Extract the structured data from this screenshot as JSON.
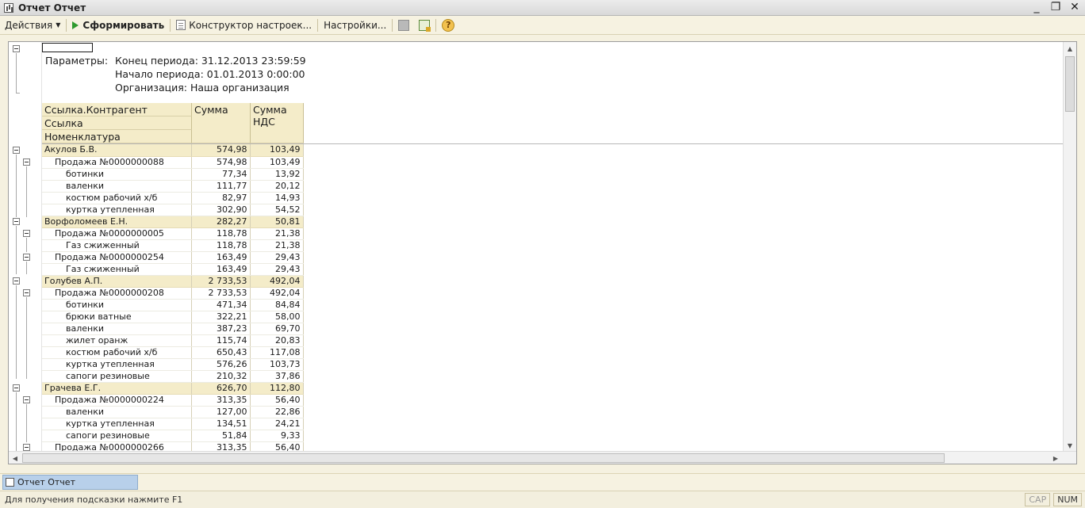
{
  "window": {
    "title": "Отчет  Отчет",
    "buttons": [
      "_",
      "❐",
      "✕"
    ]
  },
  "toolbar": {
    "actions_label": "Действия",
    "generate_label": "Сформировать",
    "constructor_label": "Конструктор настроек...",
    "settings_label": "Настройки...",
    "help_label": "?"
  },
  "report": {
    "params_label": "Параметры:",
    "params": [
      "Конец периода: 31.12.2013 23:59:59",
      "Начало периода: 01.01.2013 0:00:00",
      "Организация: Наша организация"
    ],
    "headers": {
      "group1": "Ссылка.Контрагент",
      "group2": "Ссылка",
      "group3": "Номенклатура",
      "sum": "Сумма",
      "vat_line1": "Сумма",
      "vat_line2": "НДС"
    },
    "rows": [
      {
        "level": 0,
        "name": "Акулов Б.В.",
        "sum": "574,98",
        "vat": "103,49"
      },
      {
        "level": 1,
        "name": "Продажа №0000000088",
        "sum": "574,98",
        "vat": "103,49"
      },
      {
        "level": 2,
        "name": "ботинки",
        "sum": "77,34",
        "vat": "13,92"
      },
      {
        "level": 2,
        "name": "валенки",
        "sum": "111,77",
        "vat": "20,12"
      },
      {
        "level": 2,
        "name": "костюм рабочий х/б",
        "sum": "82,97",
        "vat": "14,93"
      },
      {
        "level": 2,
        "name": "куртка утепленная",
        "sum": "302,90",
        "vat": "54,52"
      },
      {
        "level": 0,
        "name": "Ворфоломеев Е.Н.",
        "sum": "282,27",
        "vat": "50,81"
      },
      {
        "level": 1,
        "name": "Продажа №0000000005",
        "sum": "118,78",
        "vat": "21,38"
      },
      {
        "level": 2,
        "name": "Газ сжиженный",
        "sum": "118,78",
        "vat": "21,38"
      },
      {
        "level": 1,
        "name": "Продажа №0000000254",
        "sum": "163,49",
        "vat": "29,43"
      },
      {
        "level": 2,
        "name": "Газ сжиженный",
        "sum": "163,49",
        "vat": "29,43"
      },
      {
        "level": 0,
        "name": "Голубев А.П.",
        "sum": "2 733,53",
        "vat": "492,04"
      },
      {
        "level": 1,
        "name": "Продажа №0000000208",
        "sum": "2 733,53",
        "vat": "492,04"
      },
      {
        "level": 2,
        "name": "ботинки",
        "sum": "471,34",
        "vat": "84,84"
      },
      {
        "level": 2,
        "name": "брюки ватные",
        "sum": "322,21",
        "vat": "58,00"
      },
      {
        "level": 2,
        "name": "валенки",
        "sum": "387,23",
        "vat": "69,70"
      },
      {
        "level": 2,
        "name": "жилет оранж",
        "sum": "115,74",
        "vat": "20,83"
      },
      {
        "level": 2,
        "name": "костюм рабочий х/б",
        "sum": "650,43",
        "vat": "117,08"
      },
      {
        "level": 2,
        "name": "куртка утепленная",
        "sum": "576,26",
        "vat": "103,73"
      },
      {
        "level": 2,
        "name": "сапоги резиновые",
        "sum": "210,32",
        "vat": "37,86"
      },
      {
        "level": 0,
        "name": "Грачева Е.Г.",
        "sum": "626,70",
        "vat": "112,80"
      },
      {
        "level": 1,
        "name": "Продажа №0000000224",
        "sum": "313,35",
        "vat": "56,40"
      },
      {
        "level": 2,
        "name": "валенки",
        "sum": "127,00",
        "vat": "22,86"
      },
      {
        "level": 2,
        "name": "куртка утепленная",
        "sum": "134,51",
        "vat": "24,21"
      },
      {
        "level": 2,
        "name": "сапоги резиновые",
        "sum": "51,84",
        "vat": "9,33"
      },
      {
        "level": 1,
        "name": "Продажа №0000000266",
        "sum": "313,35",
        "vat": "56,40"
      }
    ]
  },
  "taskbar": {
    "tab_label": "Отчет  Отчет"
  },
  "statusbar": {
    "hint": "Для получения подсказки нажмите F1",
    "cap": "CAP",
    "num": "NUM"
  }
}
